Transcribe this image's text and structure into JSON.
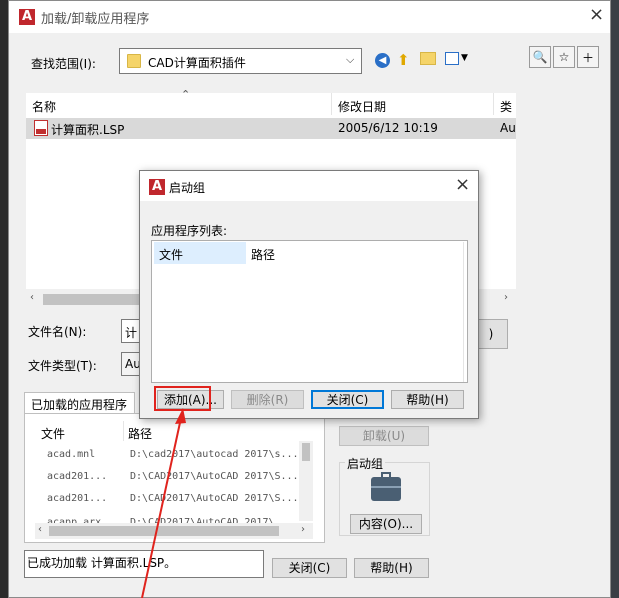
{
  "main_dialog": {
    "title": "加载/卸载应用程序",
    "look_in_label": "查找范围(I):",
    "look_in_value": "CAD计算面积插件",
    "columns": {
      "name": "名称",
      "modified": "修改日期",
      "type": "类"
    },
    "files": [
      {
        "name": "计算面积.LSP",
        "modified": "2005/6/12 10:19",
        "type": "Au"
      }
    ],
    "filename_label": "文件名(N):",
    "filename_value": "计",
    "filetype_label": "文件类型(T):",
    "filetype_value": "Au",
    "loaded_tab": "已加载的应用程序",
    "loaded_columns": {
      "file": "文件",
      "path": "路径"
    },
    "loaded_apps": [
      {
        "file": "acad.mnl",
        "path": "D:\\cad2017\\autocad 2017\\s..."
      },
      {
        "file": "acad201...",
        "path": "D:\\CAD2017\\AutoCAD 2017\\S..."
      },
      {
        "file": "acad201...",
        "path": "D:\\CAD2017\\AutoCAD 2017\\S..."
      },
      {
        "file": "acapp.arx",
        "path": "D:\\CAD2017\\AutoCAD 2017\\..."
      }
    ],
    "unload_button": "卸载(U)",
    "startup_group_label": "启动组",
    "contents_button": "内容(O)...",
    "status_text": "已成功加载 计算面积.LSP。",
    "close_button": "关闭(C)",
    "help_button": "帮助(H)",
    "load_button_partial": ")"
  },
  "suite_dialog": {
    "title": "启动组",
    "list_label": "应用程序列表:",
    "columns": {
      "file": "文件",
      "path": "路径"
    },
    "add_button": "添加(A)...",
    "remove_button": "删除(R)",
    "close_button": "关闭(C)",
    "help_button": "帮助(H)"
  },
  "colors": {
    "accent": "#0078d7",
    "highlight_red": "#e0231d",
    "autocad_red": "#c0272d",
    "folder_yellow": "#f5d469"
  }
}
